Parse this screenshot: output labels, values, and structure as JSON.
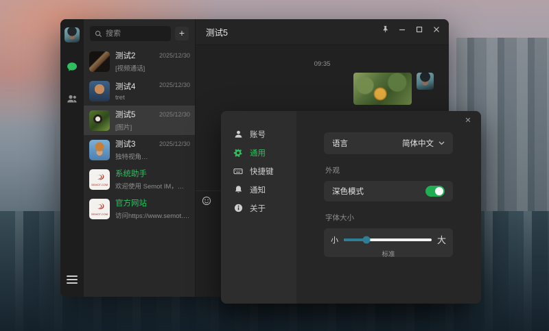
{
  "colors": {
    "accent_green": "#2fbe60",
    "toggle_green": "#21ad52",
    "slider_teal": "#2e7f95",
    "window_bg": "#212121"
  },
  "window": {
    "title": "测试5",
    "controls": {
      "pin": "pin",
      "minimize": "minimize",
      "maximize": "maximize",
      "close": "✕"
    }
  },
  "sidebar": {
    "icons": [
      "user-avatar",
      "chat-bubble",
      "contacts",
      "hamburger-menu"
    ]
  },
  "chat_list": {
    "search_placeholder": "搜索",
    "add_button": "+",
    "items": [
      {
        "name": "测试2",
        "subtitle": "[视频通话]",
        "time": "2025/12/30",
        "selected": false
      },
      {
        "name": "测试4",
        "subtitle": "tret",
        "time": "2025/12/30",
        "selected": false
      },
      {
        "name": "测试5",
        "subtitle": "[图片]",
        "time": "2025/12/30",
        "selected": true
      },
      {
        "name": "测试3",
        "subtitle": "独特视角，去解读和探讨",
        "time": "2025/12/30",
        "selected": false
      },
      {
        "name": "系统助手",
        "subtitle": "欢迎使用 Semot IM，开始聊...",
        "time": "",
        "selected": false,
        "green_name": true
      },
      {
        "name": "官方网站",
        "subtitle": "访问https://www.semot.com",
        "time": "",
        "selected": false,
        "green_name": true
      }
    ],
    "logo_text": "SEMOT.COM"
  },
  "chat": {
    "timestamp": "09:35",
    "message": {
      "type": "image",
      "sender": "self"
    }
  },
  "settings": {
    "close_label": "✕",
    "menu": [
      {
        "label": "账号",
        "icon": "user"
      },
      {
        "label": "通用",
        "icon": "gear",
        "active": true
      },
      {
        "label": "快捷键",
        "icon": "keyboard"
      },
      {
        "label": "通知",
        "icon": "bell"
      },
      {
        "label": "关于",
        "icon": "info"
      }
    ],
    "language": {
      "label": "语言",
      "value": "简体中文"
    },
    "appearance": {
      "section": "外观",
      "dark_mode_label": "深色模式",
      "dark_mode_on": true
    },
    "font_size": {
      "section": "字体大小",
      "min_label": "小",
      "max_label": "大",
      "caption": "标准",
      "percent": 26
    }
  }
}
